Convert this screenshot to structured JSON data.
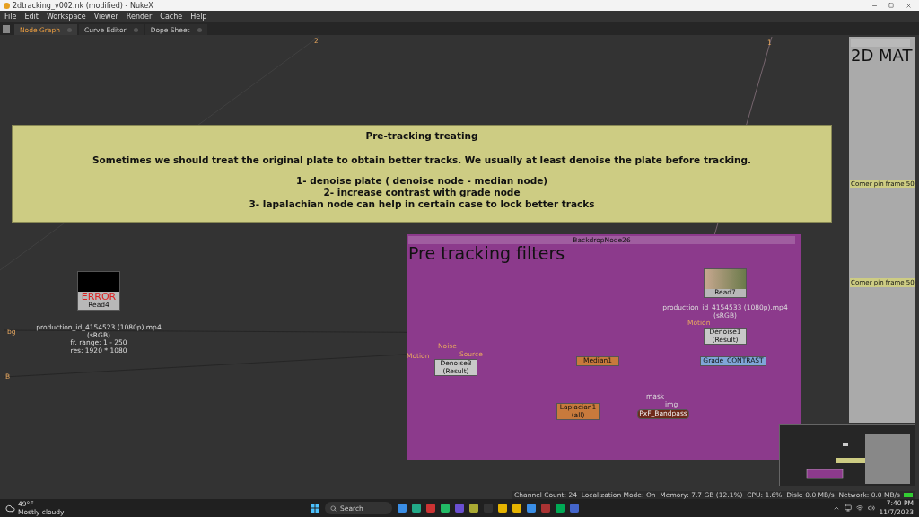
{
  "window": {
    "title": "2dtracking_v002.nk (modified) - NukeX"
  },
  "menu": [
    "File",
    "Edit",
    "Workspace",
    "Viewer",
    "Render",
    "Cache",
    "Help"
  ],
  "tabs": [
    {
      "label": "Node Graph",
      "selected": true
    },
    {
      "label": "Curve Editor",
      "selected": false
    },
    {
      "label": "Dope Sheet",
      "selected": false
    }
  ],
  "sticky_note": {
    "title": "Pre-tracking treating",
    "lines": [
      "Sometimes we should treat the original plate to obtain better tracks. We usually at least denoise the plate before tracking.",
      "1- denoise plate ( denoise node - median node)",
      "2- increase contrast with grade node",
      "3- lapalachian node can help in certain case to lock better tracks"
    ]
  },
  "backdrops": [
    {
      "title": "BackdropNode26",
      "label": "Pre tracking filters",
      "color": "#8c3a8c"
    },
    {
      "label": "2D MAT",
      "color": "#aaaaaa"
    }
  ],
  "notes": [
    "Corner pin frame 50",
    "Corner pin frame 50"
  ],
  "nodes": [
    {
      "kind": "read",
      "label": "Read4",
      "error": "ERROR",
      "lines": [
        "production_id_4154523 (1080p).mp4",
        "(sRGB)",
        "fr. range: 1 - 250",
        "res: 1920 * 1080"
      ],
      "color": "#b8b8b8"
    },
    {
      "kind": "read",
      "label": "Read7",
      "lines": [
        "production_id_4154533 (1080p).mp4",
        "(sRGB)"
      ],
      "color": "#b8b8b8"
    },
    {
      "kind": "node",
      "label": "Denoise1",
      "sub": "(Result)",
      "color": "#c8c8c8"
    },
    {
      "kind": "node",
      "label": "Denoise3",
      "sub": "(Result)",
      "color": "#c8c8c8"
    },
    {
      "kind": "node",
      "label": "Median1",
      "color": "#c87a3c"
    },
    {
      "kind": "node",
      "label": "Grade_CONTRAST",
      "color": "#7fa6d8"
    },
    {
      "kind": "node",
      "label": "Laplacian1",
      "sub": "(all)",
      "color": "#c87a3c"
    },
    {
      "kind": "pill",
      "label": "PxF_Bandpass",
      "color": "#6e2a1a"
    }
  ],
  "pipe_labels": [
    "2",
    "1",
    "bg",
    "B",
    "Noise",
    "Source",
    "Motion",
    "Motion",
    "mask",
    "img"
  ],
  "status": {
    "text": "Channel Count: 24  Localization Mode: On  Memory: 7.7 GB (12.1%)  CPU: 1.6%  Disk: 0.0 MB/s  Network: 0.0 MB/s"
  },
  "taskbar": {
    "weather_temp": "49°F",
    "weather_text": "Mostly cloudy",
    "search": "Search",
    "time": "7:40 PM",
    "date": "11/7/2023"
  }
}
